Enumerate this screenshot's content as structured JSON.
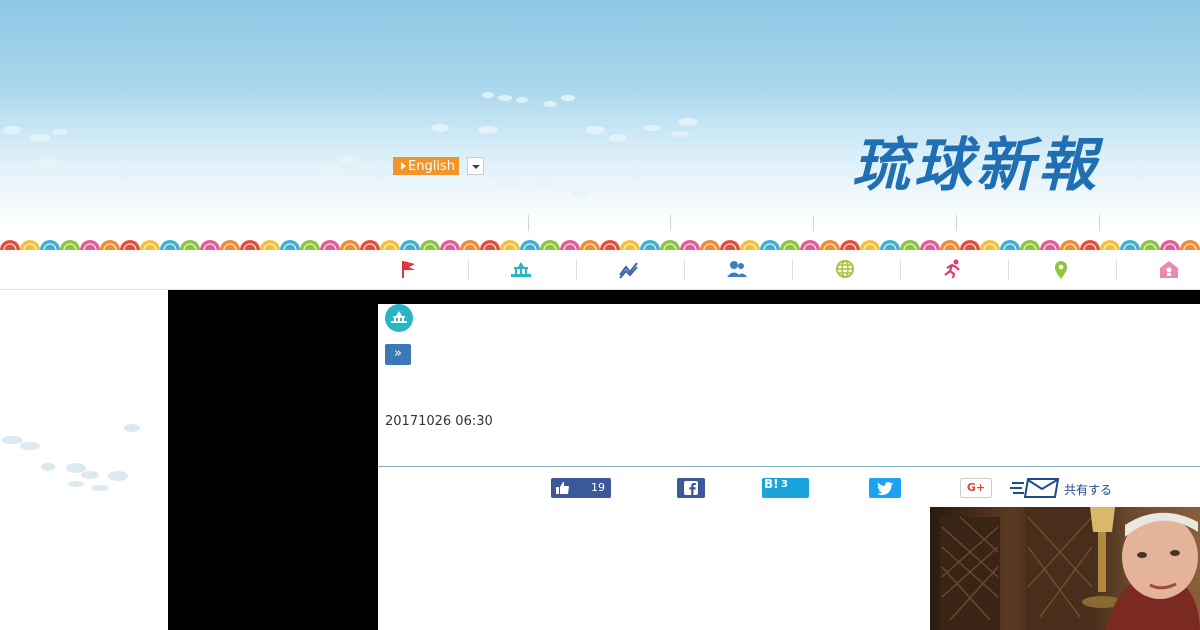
{
  "header": {
    "logo_text": "琉球新報",
    "language_label": "English"
  },
  "nav": {
    "icons": [
      "flag-icon",
      "capitol-icon",
      "trend-chart-icon",
      "people-icon",
      "globe-icon",
      "runner-icon",
      "map-pin-icon",
      "house-icon"
    ],
    "colors": [
      "#e0323b",
      "#2ab5c7",
      "#3b63a8",
      "#3b7ec2",
      "#a6c43a",
      "#e43a6a",
      "#8cc63f",
      "#e98ab5"
    ]
  },
  "article": {
    "more_label": "»",
    "datetime": "20171026 06:30"
  },
  "share": {
    "like_count": "19",
    "hatena_label": "B!",
    "hatena_count": "3",
    "gplus_label": "G+",
    "share_label": "共有する"
  },
  "colors": {
    "sky": "#8ec8e4",
    "logo": "#1f6fb2",
    "language_button": "#f0952a",
    "facebook": "#3b5998",
    "hatena": "#1aa4dd",
    "twitter": "#1da1f2"
  }
}
